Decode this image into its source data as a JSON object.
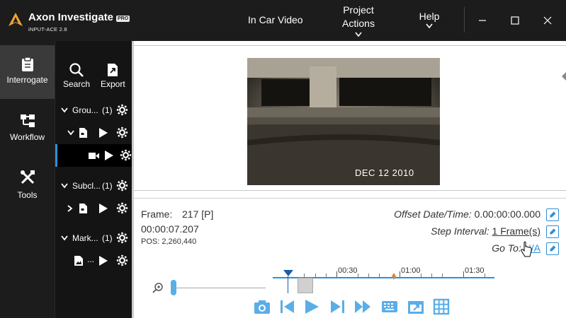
{
  "app": {
    "name": "Axon Investigate",
    "badge": "PRO",
    "subtitle": "iNPUT-ACE 2.8"
  },
  "menu": {
    "items": [
      {
        "label": "In Car Video"
      },
      {
        "label": "Project Actions"
      },
      {
        "label": "Help"
      }
    ]
  },
  "sidebar": {
    "items": [
      {
        "label": "Interrogate",
        "icon": "clipboard-icon",
        "active": true
      },
      {
        "label": "Workflow",
        "icon": "workflow-icon"
      },
      {
        "label": "Tools",
        "icon": "tools-icon"
      }
    ]
  },
  "toolbar": {
    "search_label": "Search",
    "export_label": "Export"
  },
  "tree": {
    "rows": [
      {
        "label": "Grou...",
        "count": "(1)",
        "expanded": true,
        "level": 0
      },
      {
        "label": "",
        "level": 1,
        "expanded": true,
        "icon": "file-icon"
      },
      {
        "label": "",
        "level": 2,
        "selected": true,
        "icon": "video-camera-icon"
      },
      {
        "label": "Subcl...",
        "count": "(1)",
        "expanded": true,
        "level": 0
      },
      {
        "label": "",
        "level": 1,
        "expanded": false,
        "icon": "file-icon"
      },
      {
        "label": "Mark...",
        "count": "(1)",
        "expanded": true,
        "level": 0
      },
      {
        "label": "...",
        "level": 1,
        "icon": "image-icon"
      }
    ]
  },
  "video": {
    "date_stamp": "DEC 12 2010"
  },
  "info": {
    "frame_label": "Frame:",
    "frame_value": "217 [P]",
    "timecode": "00:00:07.207",
    "pos": "POS: 2,260,440",
    "offset_label": "Offset Date/Time:",
    "offset_value": "0.00:00:00.000",
    "step_label": "Step Interval:",
    "step_value": "1 Frame(s)",
    "goto_label": "Go To:",
    "goto_value": "N/A"
  },
  "timeline": {
    "labels": [
      "00:30",
      "01:00",
      "01:30"
    ]
  },
  "colors": {
    "accent": "#2f8fd6",
    "titlebar": "#1c1c1c",
    "logo": "#f0a43a"
  }
}
